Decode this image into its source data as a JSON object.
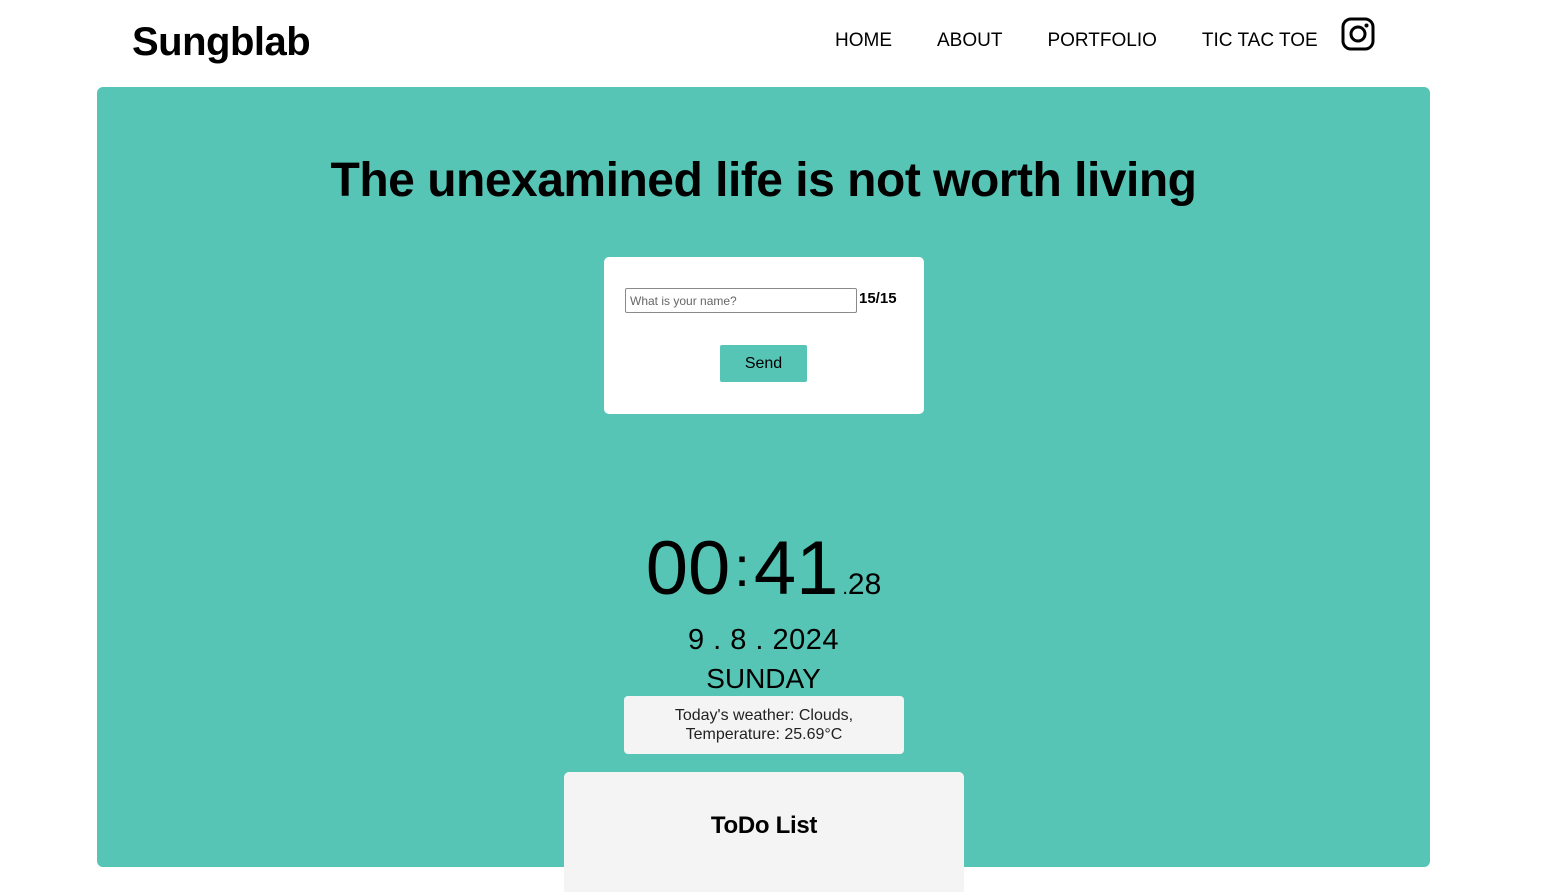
{
  "header": {
    "logo": "Sungblab",
    "nav": [
      {
        "label": "HOME"
      },
      {
        "label": "ABOUT"
      },
      {
        "label": "PORTFOLIO"
      },
      {
        "label": "TIC TAC TOE"
      }
    ],
    "social_icon": "instagram-icon"
  },
  "main": {
    "quote": "The unexamined life is not worth living",
    "name_form": {
      "placeholder": "What is your name?",
      "value": "",
      "counter": "15/15",
      "send_label": "Send"
    },
    "clock": {
      "hours": "00",
      "separator": ":",
      "minutes": "41",
      "dot": ".",
      "seconds": "28"
    },
    "date": "9 . 8 . 2024",
    "day": "SUNDAY",
    "weather": {
      "line1": "Today's weather: Clouds,",
      "line2": "Temperature: 25.69°C"
    },
    "todo": {
      "title": "ToDo List"
    }
  },
  "colors": {
    "accent": "#56c5b5",
    "card": "#ffffff",
    "panel": "#f4f4f4"
  }
}
